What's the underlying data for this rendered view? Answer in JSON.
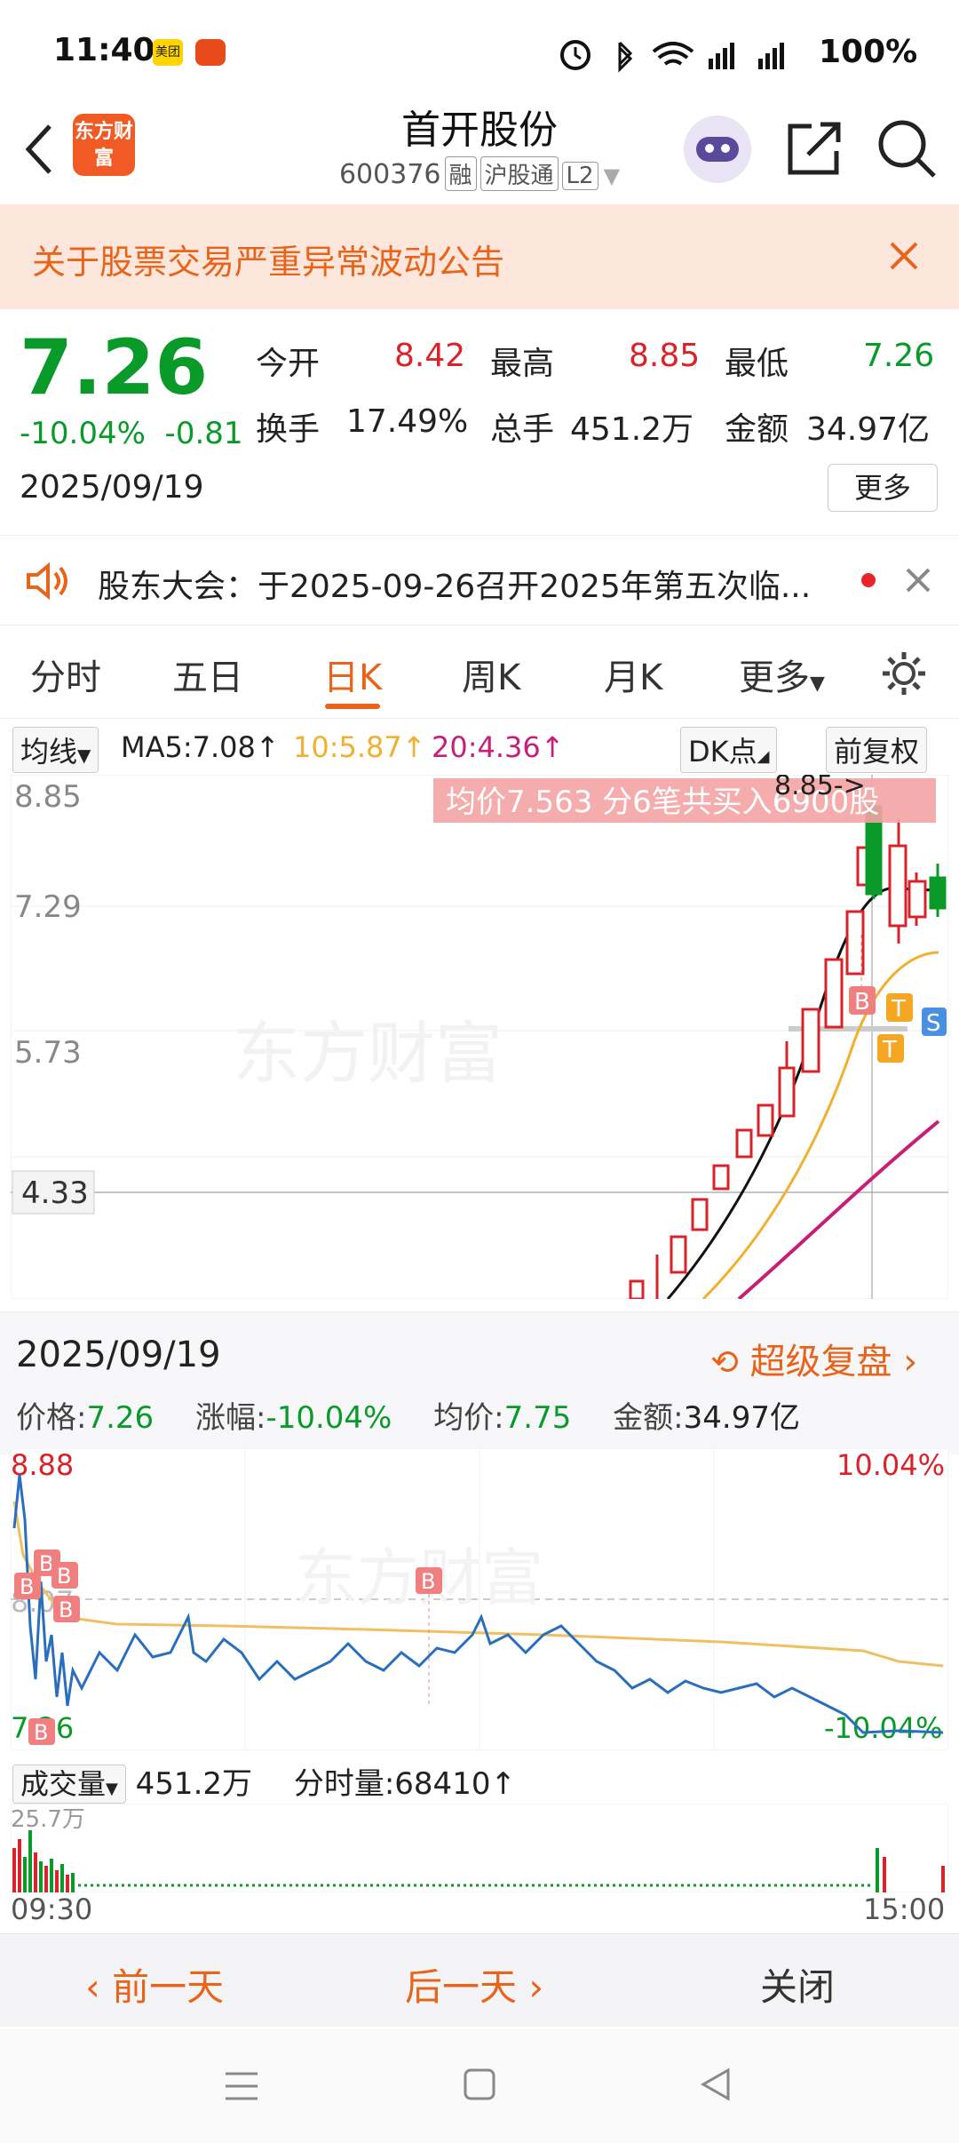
{
  "status_bar": {
    "time": "11:40",
    "app_badge_1": "美团",
    "right": "5G 5G 100%"
  },
  "header": {
    "logo_text": "东方财富",
    "title": "首开股份",
    "code": "600376",
    "tags": [
      "融",
      "沪股通",
      "L2"
    ]
  },
  "notice": {
    "text": "关于股票交易严重异常波动公告"
  },
  "quote": {
    "price": "7.26",
    "change_pct": "-10.04%",
    "change": "-0.81",
    "date": "2025/09/19",
    "open_label": "今开",
    "open": "8.42",
    "high_label": "最高",
    "high": "8.85",
    "low_label": "最低",
    "low": "7.26",
    "turnover_label": "换手",
    "turnover": "17.49%",
    "volume_label": "总手",
    "volume": "451.2万",
    "amount_label": "金额",
    "amount": "34.97亿",
    "more": "更多"
  },
  "announcement": {
    "text": "股东大会：于2025-09-26召开2025年第五次临..."
  },
  "tabs": [
    "分时",
    "五日",
    "日K",
    "周K",
    "月K",
    "更多"
  ],
  "ma_row": {
    "ma_select": "均线",
    "ma5": "MA5:7.08↑",
    "ma10": "10:5.87↑",
    "ma20": "20:4.36↑",
    "dk": "DK点",
    "adj": "前复权"
  },
  "kline": {
    "y_labels": [
      "8.85",
      "7.29",
      "5.73",
      "4.33"
    ],
    "banner": "均价7.563  分6笔共买入6900股",
    "high_marker": "8.85->",
    "watermark": "东方财富",
    "markers": [
      "B",
      "T",
      "T",
      "S"
    ]
  },
  "detail": {
    "date": "2025/09/19",
    "fupan": "超级复盘",
    "price_label": "价格:",
    "price": "7.26",
    "pct_label": "涨幅:",
    "pct": "-10.04%",
    "avg_label": "均价:",
    "avg": "7.75",
    "amount_label": "金额:",
    "amount": "34.97亿"
  },
  "intraday": {
    "top": "8.88",
    "bottom": "7.26",
    "mid": "8.07",
    "up_pct": "10.04%",
    "down_pct": "-10.04%",
    "watermark": "东方财富"
  },
  "volume": {
    "select": "成交量",
    "total": "451.2万",
    "minute_label": "分时量:",
    "minute": "68410↑",
    "scale": "25.7万",
    "time_start": "09:30",
    "time_end": "15:00"
  },
  "actions": {
    "prev": "前一天",
    "next": "后一天",
    "close": "关闭"
  },
  "colors": {
    "up": "#d8232a",
    "down": "#0a9a2a",
    "accent": "#e8641b",
    "ma10": "#f0b030",
    "ma20": "#c81e78"
  }
}
